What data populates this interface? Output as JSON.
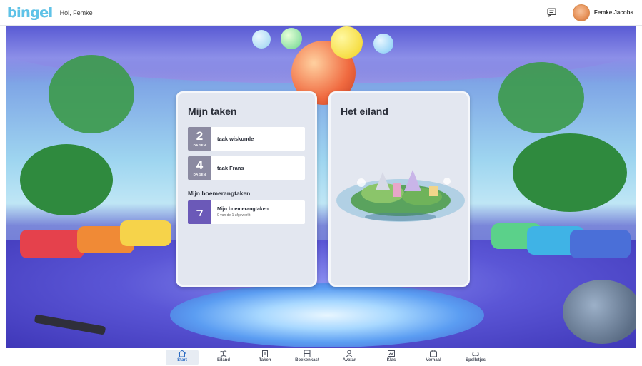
{
  "header": {
    "logo_text": "bingel",
    "greeting": "Hoi, Femke",
    "user_name": "Femke Jacobs",
    "icons": {
      "messages": "message-icon",
      "avatar": "avatar"
    }
  },
  "tasks_card": {
    "title": "Mijn taken",
    "tasks": [
      {
        "count": "2",
        "unit": "DAGEN",
        "label": "taak wiskunde"
      },
      {
        "count": "4",
        "unit": "DAGEN",
        "label": "taak Frans"
      }
    ],
    "boomerang_section": "Mijn boemerangtaken",
    "boomerang": {
      "title": "Mijn boemerangtaken",
      "subtitle": "0 van de 1 afgewerkt"
    }
  },
  "island_card": {
    "title": "Het eiland"
  },
  "nav": {
    "active": "Start",
    "items": [
      {
        "label": "Start",
        "icon": "home-icon"
      },
      {
        "label": "Eiland",
        "icon": "island-icon"
      },
      {
        "label": "Taken",
        "icon": "tasks-icon"
      },
      {
        "label": "Boekenkast",
        "icon": "bookcase-icon"
      },
      {
        "label": "Avatar",
        "icon": "avatar-icon"
      },
      {
        "label": "Klas",
        "icon": "class-icon"
      },
      {
        "label": "Verhaal",
        "icon": "story-icon"
      },
      {
        "label": "Spelletjes",
        "icon": "games-icon"
      }
    ]
  },
  "colors": {
    "accent": "#2c6bc2",
    "task_badge": "#8b8aa1",
    "boomerang_badge": "#6b59b8",
    "logo": "#5ec3e8"
  }
}
